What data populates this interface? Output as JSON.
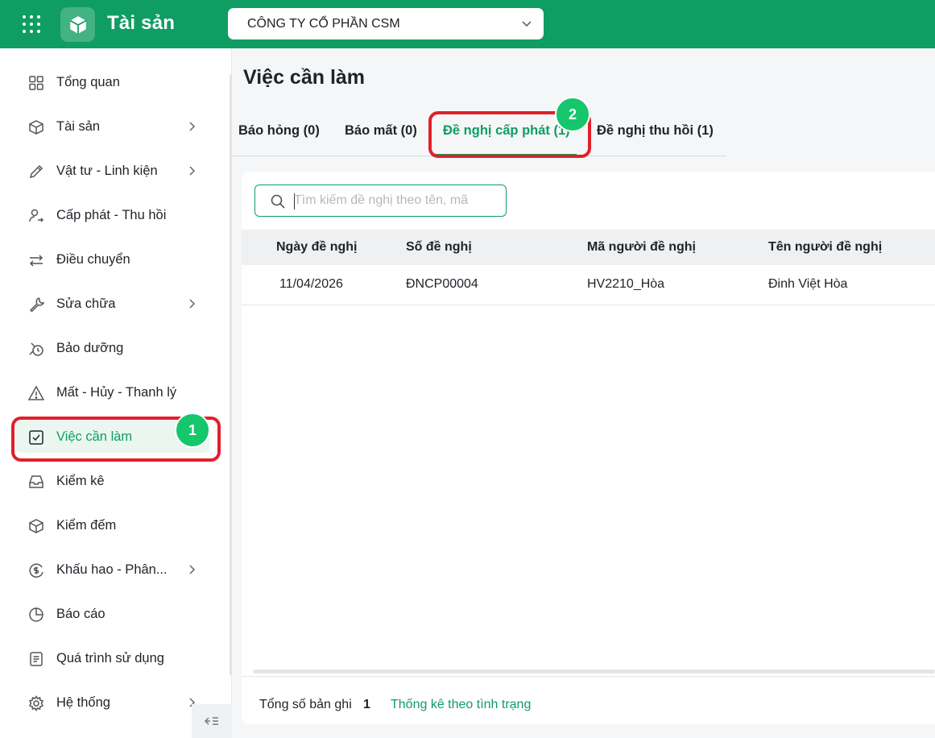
{
  "app": {
    "title": "Tài sản",
    "accent": "#0f9d63"
  },
  "header": {
    "company": "CÔNG TY CỔ PHẦN CSM"
  },
  "sidebar": {
    "items": [
      {
        "label": "Tổng quan"
      },
      {
        "label": "Tài sản"
      },
      {
        "label": "Vật tư - Linh kiện"
      },
      {
        "label": "Cấp phát - Thu hồi"
      },
      {
        "label": "Điều chuyển"
      },
      {
        "label": "Sửa chữa"
      },
      {
        "label": "Bảo dưỡng"
      },
      {
        "label": "Mất - Hủy - Thanh lý"
      },
      {
        "label": "Việc cần làm"
      },
      {
        "label": "Kiểm kê"
      },
      {
        "label": "Kiểm đếm"
      },
      {
        "label": "Khấu hao - Phân..."
      },
      {
        "label": "Báo cáo"
      },
      {
        "label": "Quá trình sử dụng"
      },
      {
        "label": "Hệ thống"
      }
    ]
  },
  "annotations": {
    "step1": "1",
    "step2": "2",
    "marker_color": "#e0202b"
  },
  "main": {
    "title": "Việc cần làm",
    "tabs": [
      {
        "label": "Báo hỏng (0)"
      },
      {
        "label": "Báo mất (0)"
      },
      {
        "label": "Đề nghị cấp phát (1)"
      },
      {
        "label": "Đề nghị thu hồi (1)"
      }
    ],
    "search": {
      "placeholder": "Tìm kiếm đề nghị theo tên, mã"
    },
    "table": {
      "headers": [
        "Ngày đề nghị",
        "Số đề nghị",
        "Mã người đề nghị",
        "Tên người đề nghị"
      ],
      "rows": [
        [
          "11/04/2026",
          "ĐNCP00004",
          "HV2210_Hòa",
          "Đinh Việt Hòa"
        ]
      ]
    },
    "footer": {
      "total_label": "Tổng số bản ghi",
      "total_value": "1",
      "stats_link": "Thống kê theo tình trạng"
    }
  }
}
